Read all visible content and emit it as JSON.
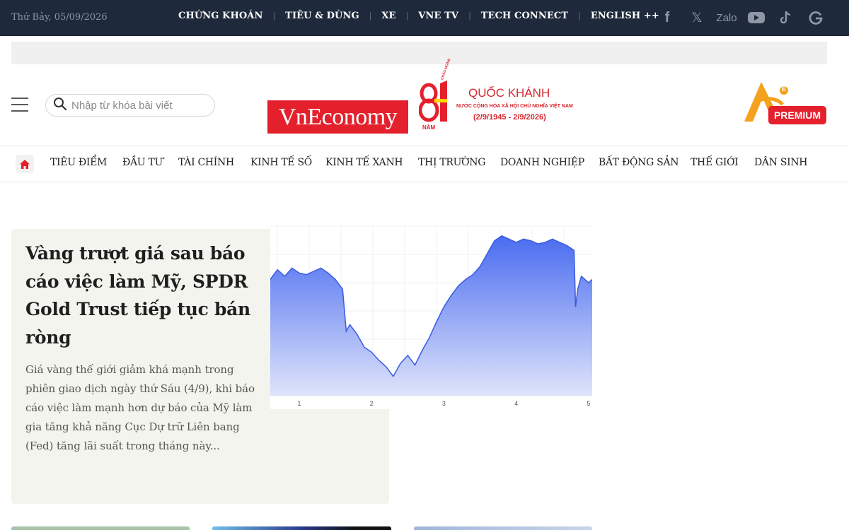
{
  "topbar": {
    "date": "Thứ Bảy, 05/09/2026",
    "nav": [
      "CHỨNG KHOÁN",
      "TIÊU & DÙNG",
      "XE",
      "VNE TV",
      "TECH CONNECT",
      "ENGLISH ++"
    ],
    "social": {
      "facebook": "f",
      "x": "𝕏",
      "zalo": "Zalo"
    }
  },
  "header": {
    "search_placeholder": "Nhập từ khóa bài viết",
    "logo": "VnEconomy",
    "celebration": {
      "number": "81",
      "ribbon": "CHÀO MỪNG",
      "unit": "NĂM",
      "title": "QUỐC KHÁNH",
      "subtitle": "NƯỚC CỘNG HÒA XÃ HỘI CHỦ NGHĨA VIỆT NAM",
      "dates": "(2/9/1945 - 2/9/2026)"
    },
    "premium_label": "PREMIUM",
    "premium_letter": "E"
  },
  "mainnav": {
    "items": [
      "TIÊU ĐIỂM",
      "ĐẦU TƯ",
      "TÀI CHÍNH",
      "KINH TẾ SỐ",
      "KINH TẾ XANH",
      "THỊ TRƯỜNG",
      "DOANH NGHIỆP",
      "BẤT ĐỘNG SẢN",
      "THẾ GIỚI",
      "DÂN SINH"
    ]
  },
  "feature": {
    "title": "Vàng trượt giá sau báo cáo việc làm Mỹ, SPDR Gold Trust tiếp tục bán ròng",
    "summary": "Giá vàng thế giới giảm khá mạnh trong phiên giao dịch ngày thứ Sáu (4/9), khi báo cáo việc làm mạnh hơn dự báo của Mỹ làm gia tăng khả năng Cục Dự trữ Liên bang (Fed) tăng lãi suất trong tháng này..."
  },
  "chart_data": {
    "type": "area",
    "x_ticks": [
      "1",
      "2",
      "3",
      "4",
      "5"
    ],
    "grid": true,
    "color": "#4a6cf0",
    "series": [
      {
        "x": [
          0.6,
          0.7,
          0.8,
          0.9,
          1.0,
          1.1,
          1.2,
          1.3,
          1.4,
          1.5,
          1.6,
          1.65,
          1.7,
          1.8,
          1.9,
          2.0,
          2.1,
          2.2,
          2.3,
          2.4,
          2.5,
          2.6,
          2.7,
          2.8,
          2.9,
          3.0,
          3.1,
          3.2,
          3.3,
          3.4,
          3.5,
          3.6,
          3.7,
          3.8,
          3.9,
          4.0,
          4.1,
          4.2,
          4.3,
          4.4,
          4.5,
          4.6,
          4.7,
          4.8,
          4.82,
          4.85,
          4.9,
          5.0,
          5.05
        ],
        "y": [
          72,
          78,
          74,
          79,
          76,
          75,
          77,
          79,
          76,
          72,
          66,
          40,
          44,
          38,
          30,
          27,
          22,
          18,
          12,
          20,
          25,
          19,
          28,
          36,
          46,
          55,
          62,
          68,
          72,
          75,
          80,
          88,
          96,
          99,
          97,
          95,
          97,
          96,
          94,
          95,
          97,
          95,
          93,
          90,
          55,
          66,
          74,
          70,
          72
        ]
      }
    ]
  },
  "colors": {
    "topbar_bg": "#1e2a3b",
    "brand_red": "#e4202d",
    "card_bg": "#f4f4ee",
    "premium_orange": "#f4a11d"
  },
  "thumbnails": [
    "thumb-1",
    "thumb-2",
    "thumb-3"
  ]
}
